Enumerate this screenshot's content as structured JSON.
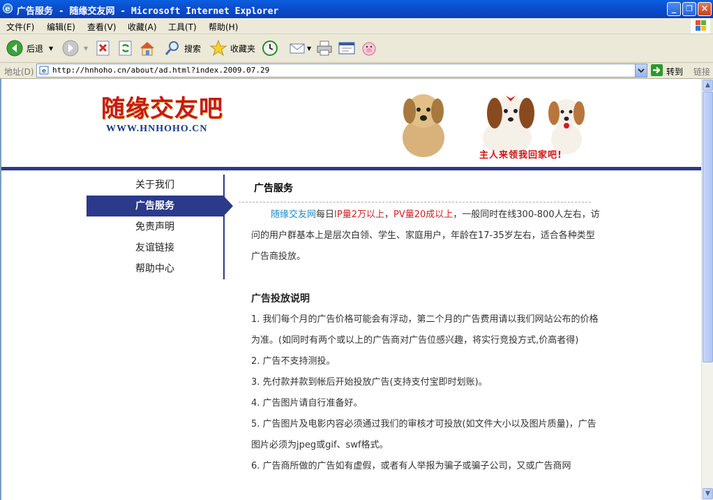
{
  "window": {
    "title": "广告服务 - 随缘交友网 - Microsoft Internet Explorer",
    "controls": [
      "_",
      "❐",
      "×"
    ]
  },
  "menu": [
    "文件(F)",
    "编辑(E)",
    "查看(V)",
    "收藏(A)",
    "工具(T)",
    "帮助(H)"
  ],
  "toolbar": {
    "back_label": "后退",
    "search_label": "搜索",
    "favorites_label": "收藏夹"
  },
  "address": {
    "label": "地址(D)",
    "url": "http://hnhoho.cn/about/ad.html?index.2009.07.29",
    "go_label": "转到",
    "links_label": "链接"
  },
  "site": {
    "logo_cn": "随缘交友吧",
    "logo_en": "WWW.HNHOHO.CN",
    "banner_text": "主人来领我回家吧!"
  },
  "nav": {
    "items": [
      "关于我们",
      "广告服务",
      "免责声明",
      "友谊链接",
      "帮助中心"
    ],
    "active": "广告服务"
  },
  "main": {
    "title": "广告服务",
    "intro": {
      "site_name": "随缘交友网",
      "t1": "每日",
      "ip": "IP量2万以上",
      "t2": "，",
      "pv": "PV量20成以上",
      "t3": "，一般同时在线300-800人左右，访问的用户群基本上是层次白领、学生、家庭用户，年龄在17-35岁左右，适合各种类型广告商投放。"
    },
    "section_title": "广告投放说明",
    "items": [
      "1. 我们每个月的广告价格可能会有浮动，第二个月的广告费用请以我们网站公布的价格为准。(如同时有两个或以上的广告商对广告位感兴趣，将实行竞投方式,价高者得)",
      "2. 广告不支持测投。",
      "3. 先付款并款到帐后开始投放广告(支持支付宝即时划账)。",
      "4. 广告图片请自行准备好。",
      "5. 广告图片及电影内容必须通过我们的审核才可投放(如文件大小以及图片质量)，广告图片必须为jpeg或gif、swf格式。",
      "6. 广告商所做的广告如有虚假，或者有人举报为骗子或骗子公司，又或广告商网"
    ]
  },
  "colors": {
    "nav_blue": "#2b3a8a",
    "accent_red": "#d62020",
    "accent_blue": "#1a8cc8",
    "titlebar_blue": "#0b4fcf"
  }
}
